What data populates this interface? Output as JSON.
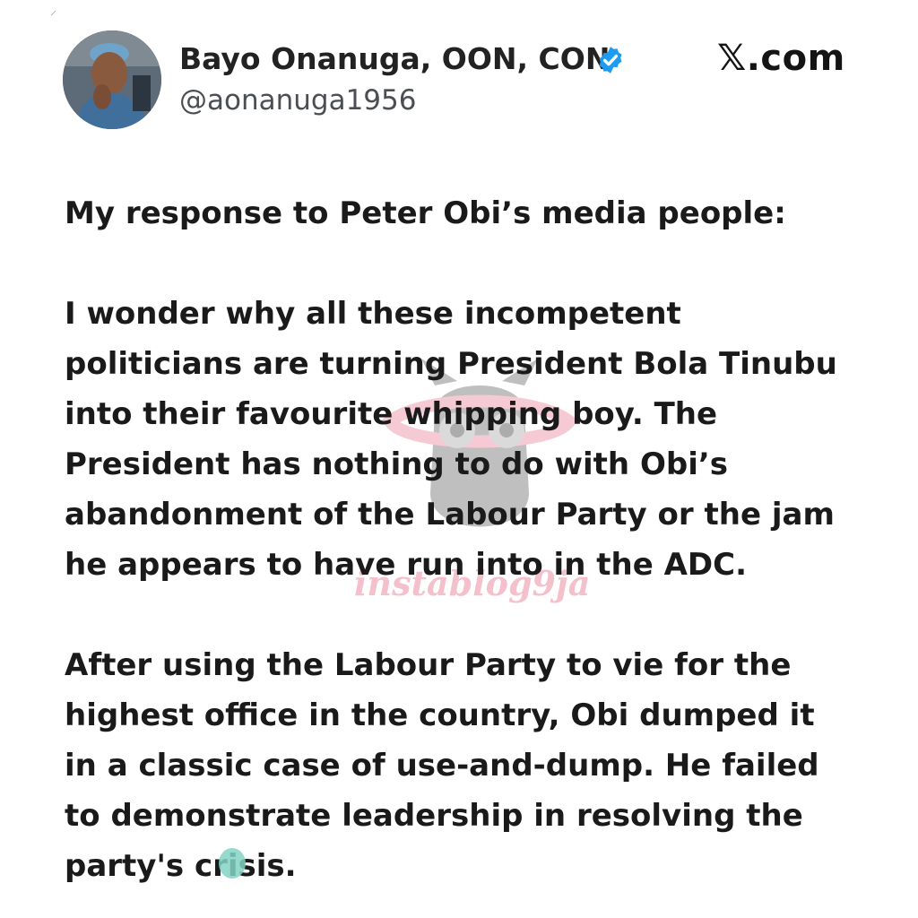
{
  "post": {
    "author_name": "Bayo Onanuga, OON, CON",
    "author_handle": "@aonanuga1956",
    "brand": "𝕏.com",
    "paragraphs": [
      "My response to Peter Obi’s media people:",
      "I wonder why all these incompetent\npoliticians are turning President Bola Tinubu\ninto their favourite whipping boy. The\nPresident has nothing to do with  Obi’s\nabandonment of the Labour Party or the jam\nhe appears to have run into in the ADC.",
      "After using the Labour Party to vie for the\nhighest office in the country, Obi dumped it\nin a classic case of use-and-dump. He failed\nto demonstrate leadership in resolving the\nparty's crisis."
    ]
  },
  "watermark": {
    "text": "instablog9ja"
  },
  "icons": {
    "verified": "verified-badge-icon",
    "avatar": "profile-avatar"
  },
  "colors": {
    "verified_blue": "#1d9bf0",
    "text": "#1a1a1a",
    "handle_gray": "#4b4f54",
    "watermark_pink": "#eb8ca0",
    "redaction_teal": "#82d3c4"
  }
}
